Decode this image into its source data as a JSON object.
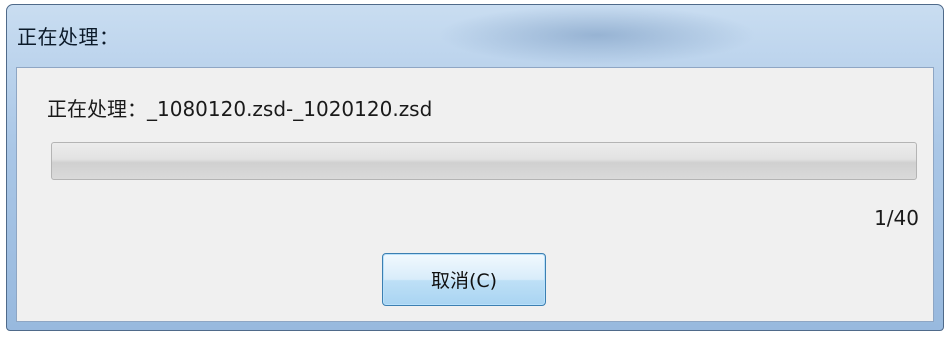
{
  "window": {
    "title": "正在处理："
  },
  "status": {
    "text": "正在处理：_1080120.zsd-_1020120.zsd"
  },
  "progress": {
    "fraction": 0.0,
    "count_text": "1/40"
  },
  "buttons": {
    "cancel_label": "取消(C)"
  },
  "colors": {
    "titlebar": "#a9c6e6",
    "client_bg": "#f0f0f0",
    "button_border": "#3c7fb1"
  }
}
